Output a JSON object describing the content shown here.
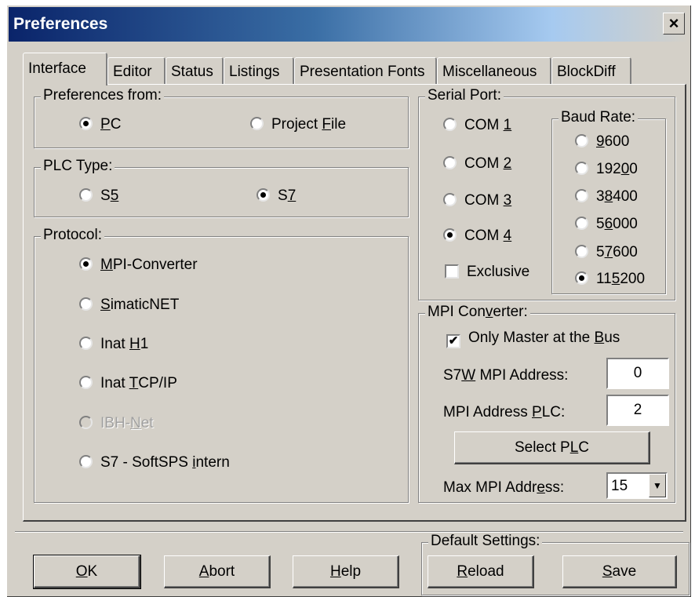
{
  "window": {
    "title": "Preferences",
    "close_label": "×"
  },
  "tabs": [
    {
      "pre": "Interface",
      "u": "",
      "post": ""
    },
    {
      "pre": "Editor",
      "u": "",
      "post": ""
    },
    {
      "pre": "Status",
      "u": "",
      "post": ""
    },
    {
      "pre": "Listings",
      "u": "",
      "post": ""
    },
    {
      "pre": "Presentation Fonts",
      "u": "",
      "post": ""
    },
    {
      "pre": "Miscellaneous",
      "u": "",
      "post": ""
    },
    {
      "pre": "BlockDiff",
      "u": "",
      "post": ""
    }
  ],
  "preferences_from": {
    "label": "Preferences from:",
    "options": [
      {
        "pre": "",
        "u": "P",
        "post": "C",
        "selected": true
      },
      {
        "pre": "Project ",
        "u": "F",
        "post": "ile",
        "selected": false
      }
    ]
  },
  "plc_type": {
    "label": "PLC Type:",
    "options": [
      {
        "pre": "S",
        "u": "5",
        "post": "",
        "selected": false
      },
      {
        "pre": "S",
        "u": "7",
        "post": "",
        "selected": true
      }
    ]
  },
  "protocol": {
    "label": "Protocol:",
    "options": [
      {
        "pre": "",
        "u": "M",
        "post": "PI-Converter",
        "selected": true,
        "disabled": false
      },
      {
        "pre": "",
        "u": "S",
        "post": "imaticNET",
        "selected": false,
        "disabled": false
      },
      {
        "pre": "Inat ",
        "u": "H",
        "post": "1",
        "selected": false,
        "disabled": false
      },
      {
        "pre": "Inat ",
        "u": "T",
        "post": "CP/IP",
        "selected": false,
        "disabled": false
      },
      {
        "pre": "IBH-",
        "u": "N",
        "post": "et",
        "selected": false,
        "disabled": true
      },
      {
        "pre": "S7 - SoftSPS ",
        "u": "i",
        "post": "ntern",
        "selected": false,
        "disabled": false
      }
    ]
  },
  "serial_port": {
    "label": "Serial Port:",
    "ports": [
      {
        "pre": "COM ",
        "u": "1",
        "post": "",
        "selected": false
      },
      {
        "pre": "COM ",
        "u": "2",
        "post": "",
        "selected": false
      },
      {
        "pre": "COM ",
        "u": "3",
        "post": "",
        "selected": false
      },
      {
        "pre": "COM ",
        "u": "4",
        "post": "",
        "selected": true
      }
    ],
    "exclusive": {
      "label": "Exclusive",
      "checked": false
    },
    "baud_rate": {
      "label": "Baud Rate:",
      "options": [
        {
          "pre": "",
          "u": "9",
          "post": "600",
          "selected": false
        },
        {
          "pre": "192",
          "u": "0",
          "post": "0",
          "selected": false
        },
        {
          "pre": "3",
          "u": "8",
          "post": "400",
          "selected": false
        },
        {
          "pre": "5",
          "u": "6",
          "post": "000",
          "selected": false
        },
        {
          "pre": "5",
          "u": "7",
          "post": "600",
          "selected": false
        },
        {
          "pre": "11",
          "u": "5",
          "post": "200",
          "selected": true
        }
      ]
    }
  },
  "mpi_converter": {
    "label_pre": "MPI Con",
    "label_u": "v",
    "label_post": "erter:",
    "only_master": {
      "pre": "Only Master at the ",
      "u": "B",
      "post": "us",
      "checked": true,
      "mark": "✔"
    },
    "s7w_address": {
      "pre": "S7",
      "u": "W",
      "post": " MPI Address:",
      "value": "0"
    },
    "plc_address": {
      "pre": "MPI Address ",
      "u": "P",
      "post": "LC:",
      "value": "2"
    },
    "select_plc": {
      "pre": "Select P",
      "u": "L",
      "post": "C"
    },
    "max_address": {
      "pre": "Max MPI Addr",
      "u": "e",
      "post": "ss:",
      "value": "15",
      "arrow": "▼"
    }
  },
  "footer": {
    "ok": {
      "pre": "",
      "u": "O",
      "post": "K"
    },
    "abort": {
      "pre": "",
      "u": "A",
      "post": "bort"
    },
    "help": {
      "pre": "",
      "u": "H",
      "post": "elp"
    },
    "default_settings": {
      "label": "Default Settings:",
      "reload": {
        "pre": "",
        "u": "R",
        "post": "eload"
      },
      "save": {
        "pre": "",
        "u": "S",
        "post": "ave"
      }
    }
  }
}
